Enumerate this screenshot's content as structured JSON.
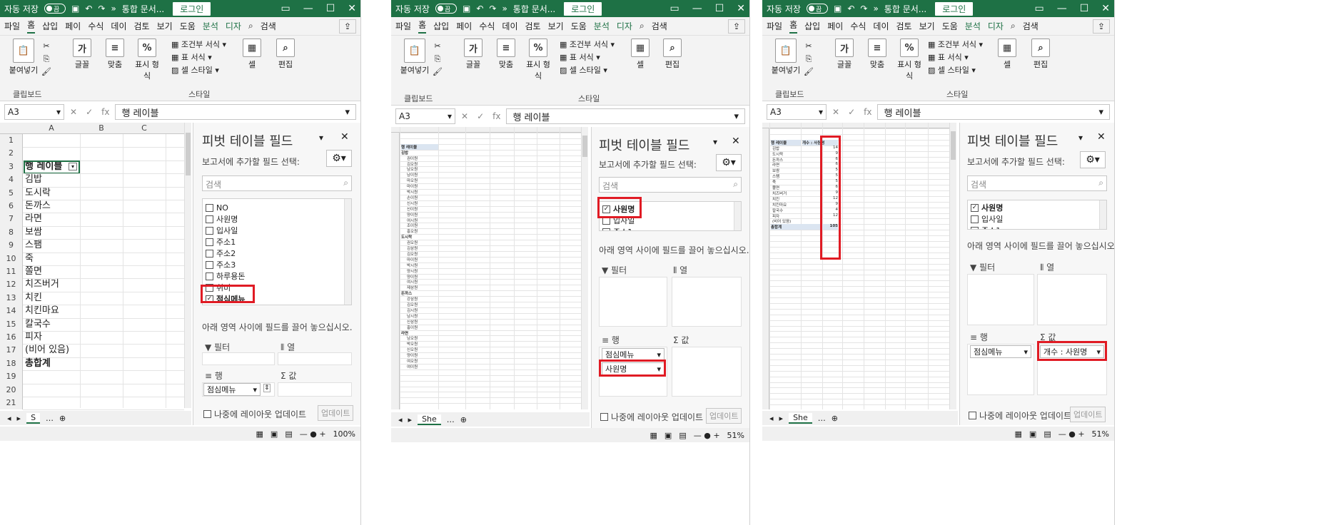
{
  "colors": {
    "excel_green": "#1e7145",
    "highlight_red": "#e01b24",
    "pivot_header_blue": "#dbe5f1"
  },
  "titlebar": {
    "autosave": "자동 저장",
    "autosave_state": "끔",
    "doc_title": "통합 문서...",
    "login": "로그인"
  },
  "menu": {
    "items": [
      "파일",
      "홈",
      "삽입",
      "페이",
      "수식",
      "데이",
      "검토",
      "보기",
      "도움",
      "분석",
      "디자"
    ],
    "search": "검색"
  },
  "ribbon": {
    "paste": "붙여넣기",
    "clipboard": "클립보드",
    "font": "글꼴",
    "align": "맞춤",
    "number": "표시 형식",
    "cond_format": "조건부 서식",
    "table_format": "표 서식",
    "cell_style": "셀 스타일",
    "style_group": "스타일",
    "cells": "셀",
    "editing": "편집"
  },
  "formula_bar": {
    "name_box": "A3",
    "content": "행 레이블"
  },
  "panel1": {
    "columns": [
      "A",
      "B",
      "C"
    ],
    "rows": [
      "1",
      "2",
      "3",
      "4",
      "5",
      "6",
      "7",
      "8",
      "9",
      "10",
      "11",
      "12",
      "13",
      "14",
      "15",
      "16",
      "17",
      "18",
      "19",
      "20",
      "21"
    ],
    "cells": [
      "",
      "",
      "행 레이블",
      "김밥",
      "도시락",
      "돈까스",
      "라면",
      "보쌈",
      "스팸",
      "죽",
      "쫄면",
      "치즈버거",
      "치킨",
      "치킨마요",
      "칼국수",
      "피자",
      "(비어 있음)",
      "총합계",
      "",
      "",
      ""
    ],
    "sheet_tab": "S",
    "zoom": "100%"
  },
  "panel2": {
    "sheet_tab": "She",
    "zoom": "51%"
  },
  "panel3": {
    "sheet_tab": "She",
    "zoom": "51%"
  },
  "pivot_pane": {
    "title": "피벗 테이블 필드",
    "subtitle": "보고서에 추가할 필드 선택:",
    "search_placeholder": "검색",
    "drag_hint": "아래 영역 사이에 필드를 끌어 놓으십시오.",
    "filter": "필터",
    "columns": "열",
    "rows": "행",
    "values": "값",
    "defer": "나중에 레이아웃 업데이트",
    "update": "업데이트"
  },
  "pane1_fields": [
    {
      "name": "NO",
      "checked": false
    },
    {
      "name": "사원명",
      "checked": false
    },
    {
      "name": "입사일",
      "checked": false
    },
    {
      "name": "주소1",
      "checked": false
    },
    {
      "name": "주소2",
      "checked": false
    },
    {
      "name": "주소3",
      "checked": false
    },
    {
      "name": "하루용돈",
      "checked": false
    },
    {
      "name": "취미",
      "checked": false
    },
    {
      "name": "점심메뉴",
      "checked": true
    }
  ],
  "pane1_rows_chip": "점심메뉴",
  "pane2_fields": [
    {
      "name": "사원명",
      "checked": true
    },
    {
      "name": "입사일",
      "checked": false
    },
    {
      "name": "주소1",
      "checked": false
    }
  ],
  "pane2_rows_chips": [
    "점심메뉴",
    "사원명"
  ],
  "pane3_fields": [
    {
      "name": "사원명",
      "checked": true
    },
    {
      "name": "입사일",
      "checked": false
    },
    {
      "name": "주소1",
      "checked": false
    }
  ],
  "pane3_rows_chip": "점심메뉴",
  "pane3_values_chip": "개수 : 사원명",
  "panel2_pivot": {
    "header": "행 레이블",
    "groups": [
      {
        "name": "김밥",
        "items": [
          "권이원",
          "김오원",
          "남오원",
          "남이원",
          "마오원",
          "마이원",
          "박시원",
          "손이원",
          "신시원",
          "신이원",
          "양이원",
          "여시원",
          "조이원",
          "홍오원"
        ]
      },
      {
        "name": "도시락",
        "items": [
          "권오원",
          "김삼원",
          "김오원",
          "마이원",
          "박시원",
          "양시원",
          "양이원",
          "여시원",
          "제삼원"
        ]
      },
      {
        "name": "돈까스",
        "items": [
          "강삼원",
          "김오원",
          "김시원",
          "남시원",
          "신삼원",
          "홍이원"
        ]
      },
      {
        "name": "라면",
        "items": [
          "남오원",
          "박오원",
          "신오원",
          "양이원",
          "여오원",
          "여이원"
        ]
      }
    ]
  },
  "panel3_pivot": {
    "header_a": "행 레이블",
    "header_b": "개수 : 사원명",
    "rows": [
      {
        "label": "김밥",
        "count": "14"
      },
      {
        "label": "도시락",
        "count": "9"
      },
      {
        "label": "돈까스",
        "count": "6"
      },
      {
        "label": "라면",
        "count": "6"
      },
      {
        "label": "보쌈",
        "count": "5"
      },
      {
        "label": "스팸",
        "count": "5"
      },
      {
        "label": "죽",
        "count": "5"
      },
      {
        "label": "쫄면",
        "count": "6"
      },
      {
        "label": "치즈버거",
        "count": "9"
      },
      {
        "label": "치킨",
        "count": "12"
      },
      {
        "label": "치킨마요",
        "count": "9"
      },
      {
        "label": "칼국수",
        "count": "4"
      },
      {
        "label": "피자",
        "count": "12"
      },
      {
        "label": "(비어 있음)",
        "count": ""
      }
    ],
    "total_label": "총합계",
    "total_count": "105"
  }
}
